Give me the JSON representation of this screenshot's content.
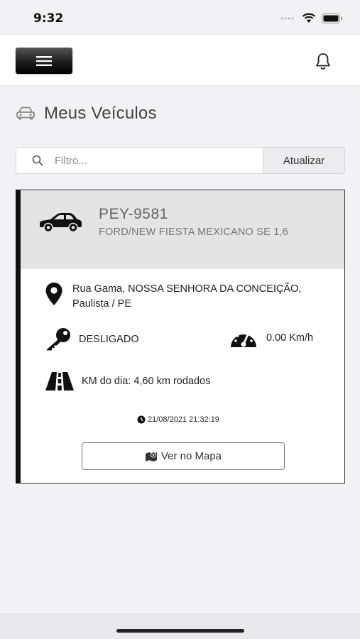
{
  "status": {
    "time": "9:32"
  },
  "navbar": {
    "menu_icon": "hamburger-icon",
    "bell_icon": "bell-icon"
  },
  "page": {
    "title": "Meus Veículos",
    "title_icon": "car-icon"
  },
  "search": {
    "placeholder": "Filtro...",
    "value": "",
    "refresh_label": "Atualizar"
  },
  "vehicle": {
    "plate": "PEY-9581",
    "model": "FORD/NEW FIESTA MEXICANO SE 1,6",
    "address_line1": "Rua Gama, NOSSA SENHORA DA CONCEIÇÃO,",
    "address_line2": "Paulista / PE",
    "ignition": "DESLIGADO",
    "speed": "0.00 Km/h",
    "km_today": "KM do dia: 4,60 km rodados",
    "timestamp": "21/08/2021 21:32:19",
    "map_button": "Ver no Mapa",
    "accent_color": "#111111"
  }
}
